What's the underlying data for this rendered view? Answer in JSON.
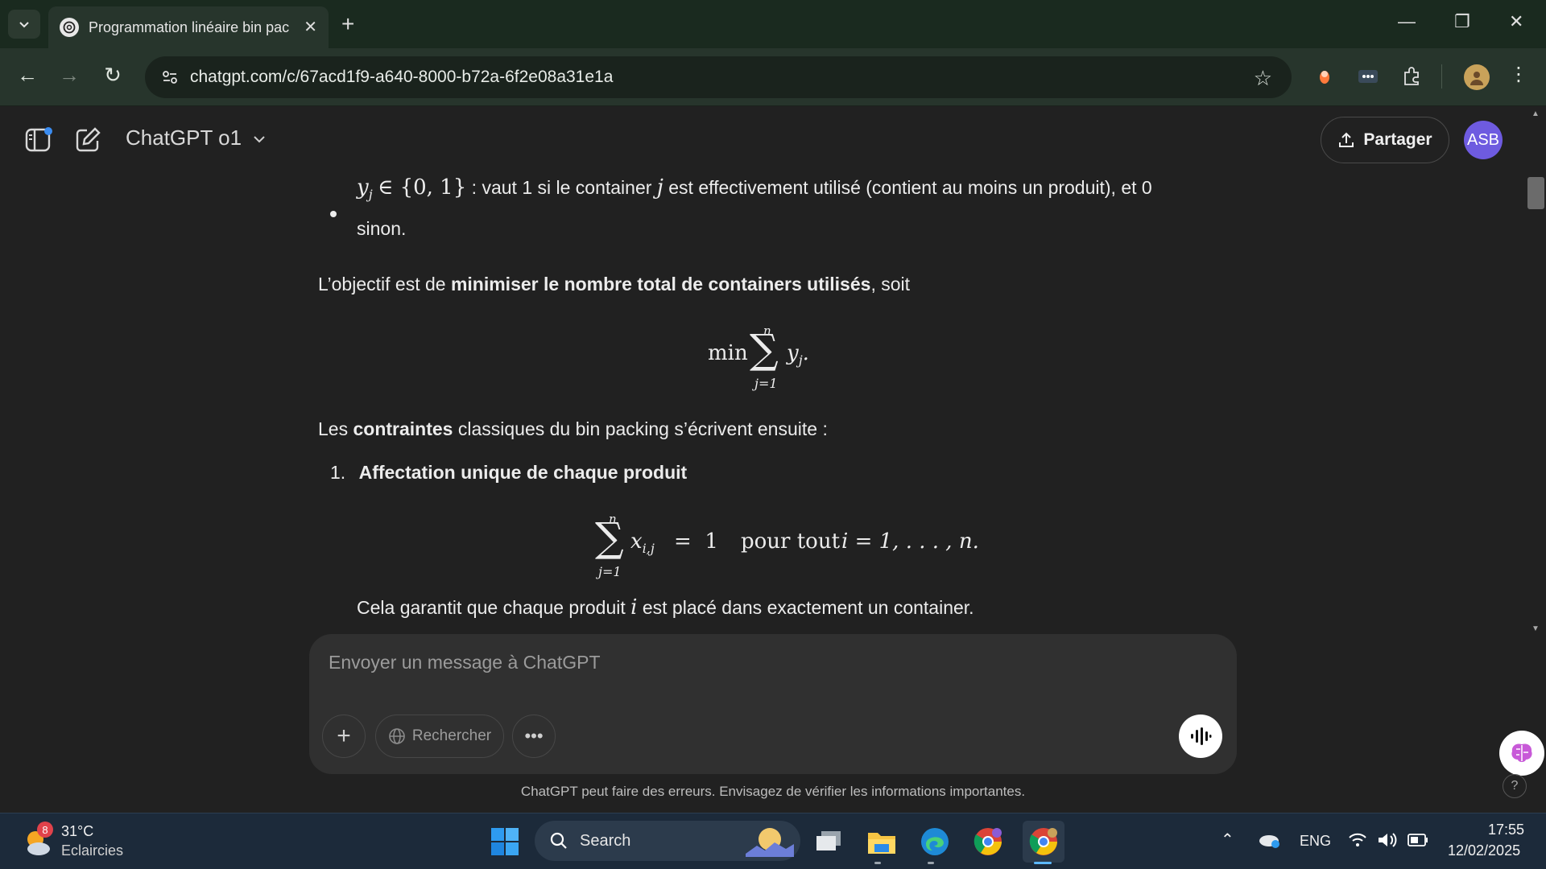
{
  "browser": {
    "tab_title": "Programmation linéaire bin pac",
    "url": "chatgpt.com/c/67acd1f9-a640-8000-b72a-6f2e08a31e1a"
  },
  "app": {
    "model_name": "ChatGPT o1",
    "share_label": "Partager",
    "avatar_initials": "ASB"
  },
  "content": {
    "bullet_text_1": " : vaut 1 si le container ",
    "bullet_text_2": " est effectivement utilisé (contient au moins un produit), et 0",
    "bullet_text_3": "sinon.",
    "objective_prefix": "L’objectif est de ",
    "objective_bold": "minimiser le nombre total de containers utilisés",
    "objective_suffix": ", soit",
    "constraints_prefix": "Les ",
    "constraints_bold": "contraintes",
    "constraints_suffix": " classiques du bin packing s’écrivent ensuite :",
    "item1_number": "1.",
    "item1_title": "Affectation unique de chaque produit",
    "formula_pour_tout": "pour tout",
    "guarantee_prefix": "Cela garantit que chaque produit ",
    "guarantee_suffix": " est placé dans exactement un container."
  },
  "composer": {
    "placeholder": "Envoyer un message à ChatGPT",
    "search_label": "Rechercher"
  },
  "disclaimer": "ChatGPT peut faire des erreurs. Envisagez de vérifier les informations importantes.",
  "taskbar": {
    "weather_temp": "31°C",
    "weather_desc": "Eclaircies",
    "weather_badge": "8",
    "search_label": "Search",
    "lang": "ENG",
    "time": "17:55",
    "date": "12/02/2025"
  }
}
